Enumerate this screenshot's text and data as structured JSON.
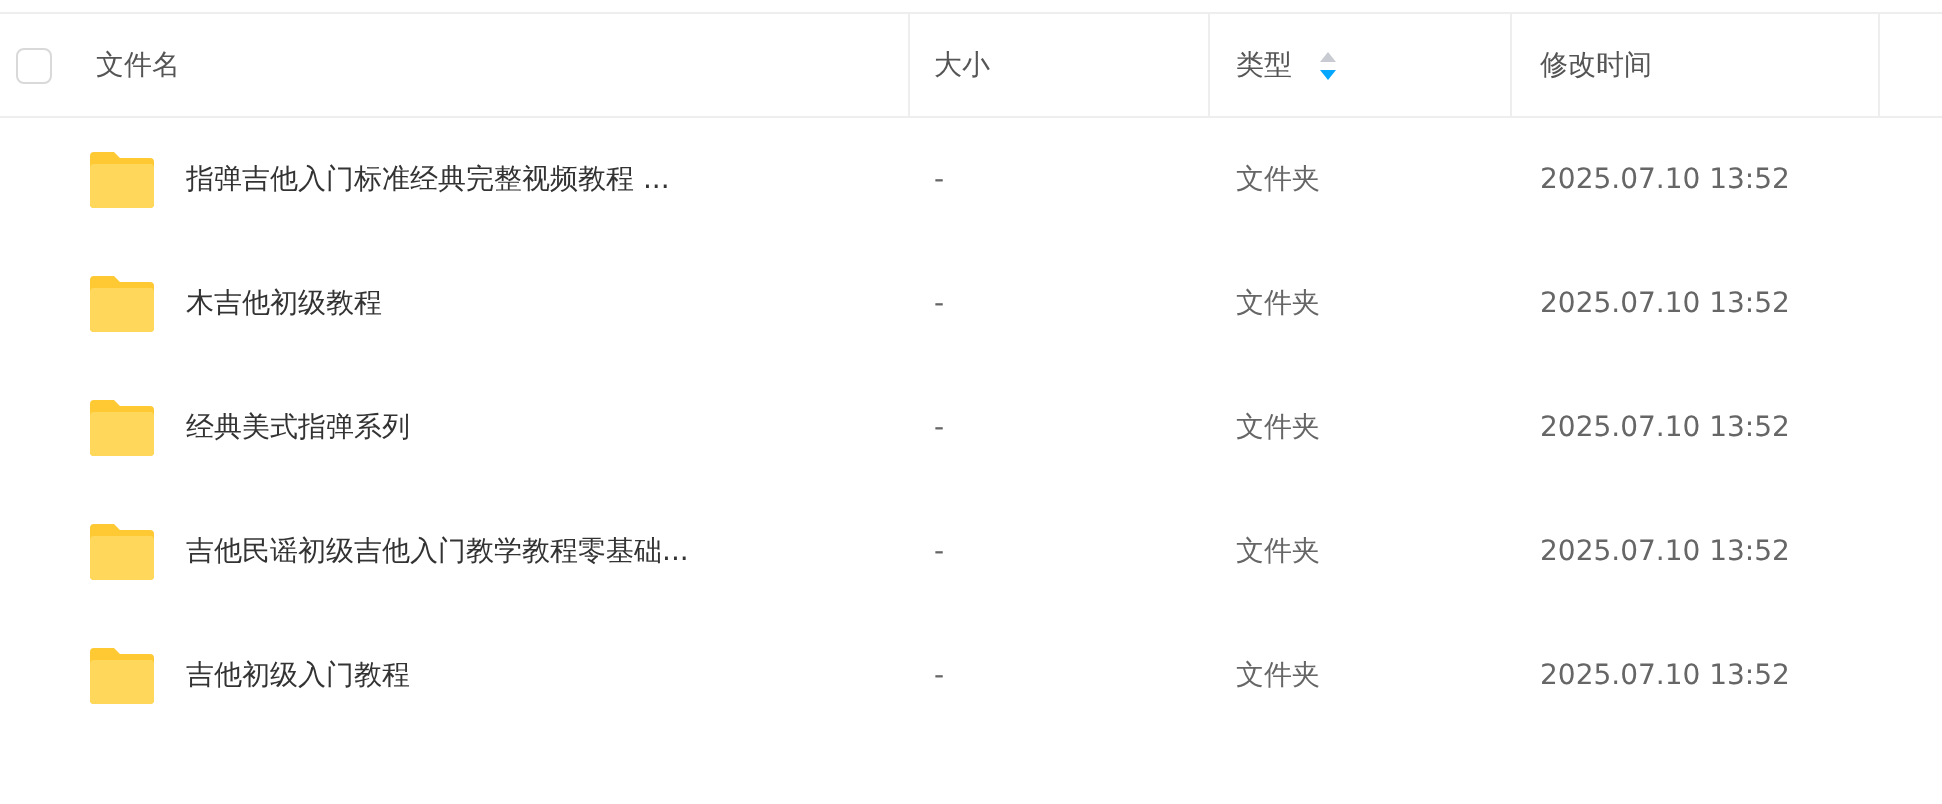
{
  "table": {
    "select_all": {
      "checked": false
    },
    "columns": [
      {
        "label": "文件名",
        "sorted": false
      },
      {
        "label": "大小",
        "sorted": false
      },
      {
        "label": "类型",
        "sorted": true,
        "descending": true
      },
      {
        "label": "修改时间",
        "sorted": false
      }
    ],
    "rows": [
      {
        "name": "指弹吉他入门标准经典完整视频教程 ...",
        "size": "-",
        "type": "文件夹",
        "modified": "2025.07.10 13:52"
      },
      {
        "name": "木吉他初级教程",
        "size": "-",
        "type": "文件夹",
        "modified": "2025.07.10 13:52"
      },
      {
        "name": "经典美式指弹系列",
        "size": "-",
        "type": "文件夹",
        "modified": "2025.07.10 13:52"
      },
      {
        "name": "吉他民谣初级吉他入门教学教程零基础...",
        "size": "-",
        "type": "文件夹",
        "modified": "2025.07.10 13:52"
      },
      {
        "name": "吉他初级入门教程",
        "size": "-",
        "type": "文件夹",
        "modified": "2025.07.10 13:52"
      }
    ]
  }
}
